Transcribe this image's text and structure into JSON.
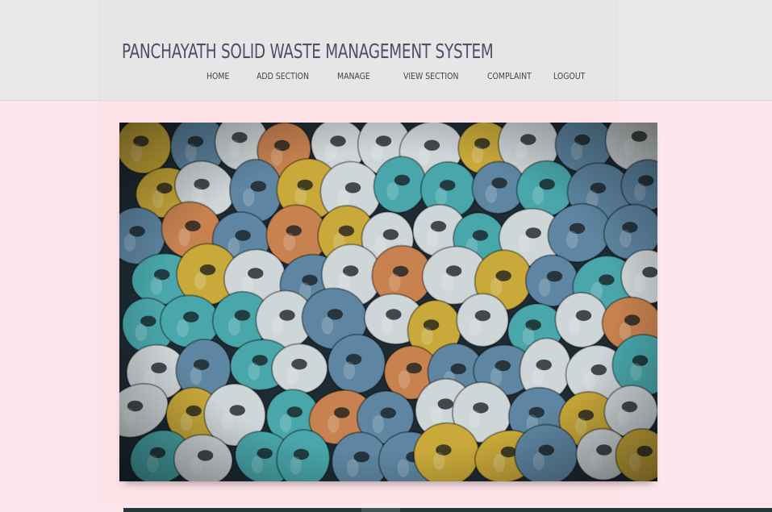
{
  "header": {
    "title": "PANCHAYATH SOLID WASTE MANAGEMENT SYSTEM"
  },
  "nav": {
    "items": [
      {
        "label": "HOME",
        "key": "home"
      },
      {
        "label": "ADD SECTION",
        "key": "add-section"
      },
      {
        "label": "MANAGE",
        "key": "manage"
      },
      {
        "label": "VIEW SECTION",
        "key": "view-section"
      },
      {
        "label": "COMPLAINT",
        "key": "complaint"
      },
      {
        "label": "LOGOUT",
        "key": "logout"
      }
    ]
  },
  "hero": {
    "colors": {
      "teal": "#49a7ab",
      "yellow": "#c9a93a",
      "white": "#cfd6d8",
      "blue": "#5e86a2",
      "orange": "#c7824f",
      "dark": "#1e2b33"
    }
  }
}
